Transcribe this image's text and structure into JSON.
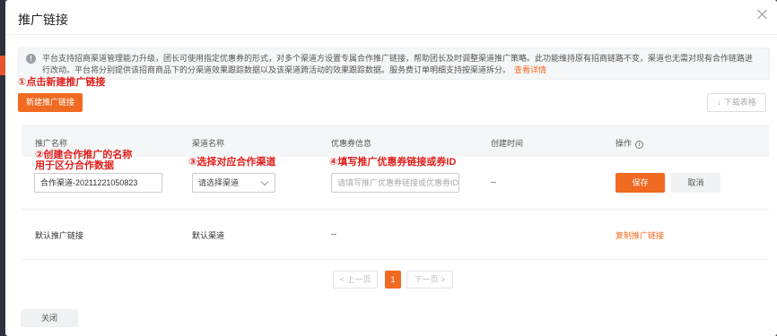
{
  "modal": {
    "title": "推广链接"
  },
  "notice": {
    "text": "平台支持招商渠道管理能力升级，团长可使用指定优惠券的形式，对多个渠道方设置专属合作推广链接，帮助团长及时调整渠道推广策略。此功能维持原有招商链路不变，渠道也无需对现有合作链路进行改动。平台将分别提供该招商商品下的分渠道效果跟踪数据以及该渠道跨活动的效果跟踪数据。服务费订单明细支持按渠道拆分。",
    "link": "查看详情"
  },
  "annotations": {
    "step1": "①点击新建推广链接",
    "step2_line1": "②创建合作推广的名称",
    "step2_line2": "用于区分合作数据",
    "step3": "③选择对应合作渠道",
    "step4": "④填写推广优惠券链接或券ID"
  },
  "toolbar": {
    "new_button": "新建推广链接",
    "download_button": "下载表格",
    "download_icon": "↓"
  },
  "table": {
    "headers": [
      "推广名称",
      "渠道名称",
      "优惠券信息",
      "创建时间",
      "操作"
    ],
    "operation_help_icon": "i",
    "edit_row": {
      "name_value": "合作渠道-20211221050823",
      "channel_placeholder": "请选择渠道",
      "coupon_placeholder": "请填写推广优惠券链接或优惠券ID",
      "created_time": "--",
      "save_button": "保存",
      "cancel_button": "取消"
    },
    "default_row": {
      "name": "默认推广链接",
      "channel": "默认渠道",
      "coupon": "--",
      "action": "复制推广链接"
    }
  },
  "pagination": {
    "prev": "< 上一页",
    "current": "1",
    "next": "下一页 >"
  },
  "footer": {
    "close_button": "关闭"
  },
  "colors": {
    "accent": "#f06a22",
    "annotation": "#e0201c"
  }
}
